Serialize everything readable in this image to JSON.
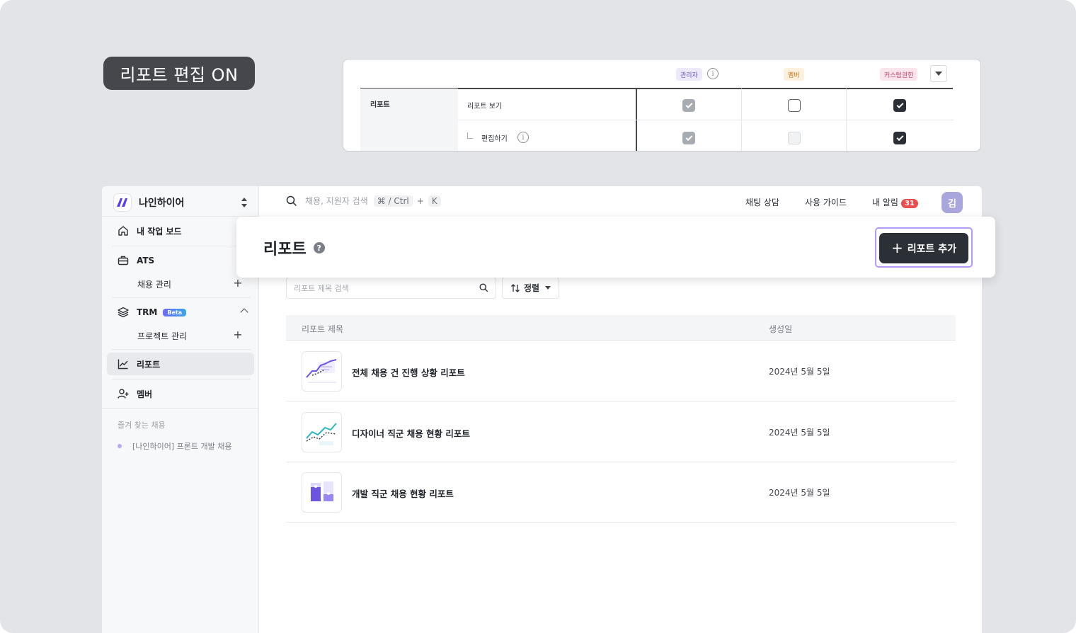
{
  "badge": {
    "text": "리포트 편집 ON"
  },
  "permissions": {
    "roles": {
      "admin": "관리자",
      "member": "멤버",
      "custom": "커스텀권한"
    },
    "category": "리포트",
    "rows": [
      {
        "label": "리포트 보기",
        "admin": "checked-disabled",
        "member": "unchecked",
        "custom": "checked"
      },
      {
        "label": "편집하기",
        "admin": "checked-disabled",
        "member": "disabled",
        "custom": "checked"
      }
    ]
  },
  "sidebar": {
    "workspace": "나인하이어",
    "items": {
      "home": "내 작업 보드",
      "ats": "ATS",
      "recruit": "채용 관리",
      "trm": "TRM",
      "trm_badge": "Beta",
      "project": "프로젝트 관리",
      "report": "리포트",
      "member": "멤버"
    },
    "favorites_title": "즐겨 찾는 채용",
    "favorites": [
      "[나인하이어] 프론트 개발 채용"
    ]
  },
  "topbar": {
    "search_placeholder": "채용, 지원자 검색",
    "shortcut": "⌘ / Ctrl",
    "plus": "+",
    "key": "K",
    "chat": "채팅 상담",
    "guide": "사용 가이드",
    "alarm": "내 알림",
    "alarm_count": "31",
    "avatar": "김"
  },
  "page": {
    "title": "리포트",
    "help": "?",
    "add_button": "리포트 추가"
  },
  "list": {
    "search_placeholder": "리포트 제목 검색",
    "sort_label": "정렬",
    "columns": {
      "title": "리포트 제목",
      "date": "생성일"
    },
    "rows": [
      {
        "title": "전체 채용 건 진행 상황 리포트",
        "date": "2024년 5월 5일"
      },
      {
        "title": "디자이너 직군 채용 현황 리포트",
        "date": "2024년 5월 5일"
      },
      {
        "title": "개발 직군 채용 현황 리포트",
        "date": "2024년 5월 5일"
      }
    ]
  },
  "colors": {
    "accent": "#7b5cf0",
    "dark": "#2b2f36",
    "alarm": "#ea4c4c"
  }
}
